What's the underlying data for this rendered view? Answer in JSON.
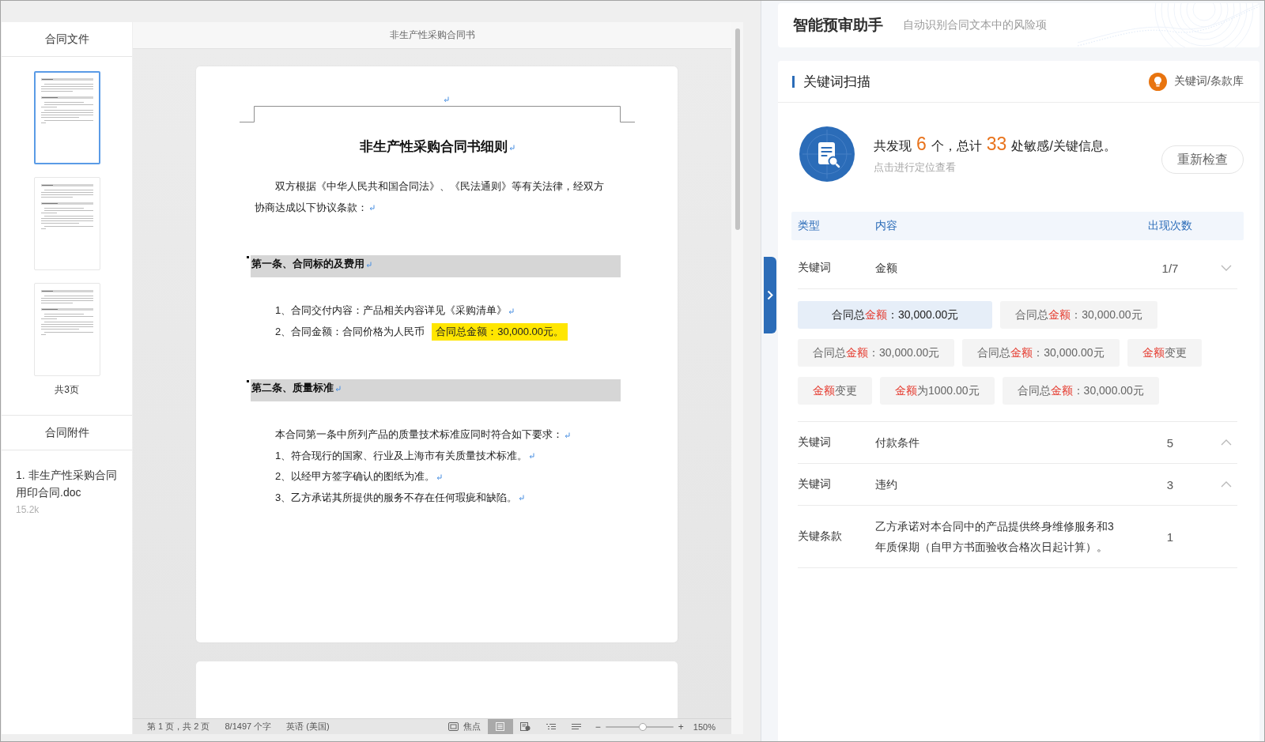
{
  "sidebar": {
    "title": "合同文件",
    "pages": [
      {
        "selected": true
      },
      {
        "selected": false
      },
      {
        "selected": false
      }
    ],
    "page_count": "共3页",
    "attachments_title": "合同附件",
    "attachments": [
      {
        "name": "1. 非生产性采购合同用印合同.doc",
        "size": "15.2k"
      }
    ]
  },
  "document": {
    "tab_title": "非生产性采购合同书",
    "header_mark": true,
    "blocks": [
      {
        "kind": "title",
        "text": "非生产性采购合同书细则",
        "mark": true
      },
      {
        "kind": "paragraph",
        "text": "双方根据《中华人民共和国合同法》、《民法通则》等有关法律，经双方协商达成以下协议条款：",
        "mark": true
      },
      {
        "kind": "heading",
        "text": "第一条、合同标的及费用",
        "mark": true
      },
      {
        "kind": "paragraph",
        "text": "1、合同交付内容：产品相关内容详见《采购清单》",
        "mark": true
      },
      {
        "kind": "paragraph",
        "text": "2、合同金额：合同价格为人民币",
        "highlight": "合同总金额：30,000.00元。",
        "mark": false
      },
      {
        "kind": "heading",
        "text": "第二条、质量标准",
        "mark": true
      },
      {
        "kind": "paragraph",
        "text": "本合同第一条中所列产品的质量技术标准应同时符合如下要求：",
        "mark": true
      },
      {
        "kind": "paragraph",
        "text": "1、符合现行的国家、行业及上海市有关质量技术标准。",
        "mark": true
      },
      {
        "kind": "paragraph",
        "text": "2、以经甲方签字确认的图纸为准。",
        "mark": true
      },
      {
        "kind": "paragraph",
        "text": "3、乙方承诺其所提供的服务不存在任何瑕疵和缺陷。",
        "mark": true
      }
    ]
  },
  "status_bar": {
    "page_info": "第 1 页，共 2 页",
    "word_count": "8/1497 个字",
    "language": "英语 (美国)",
    "focus": "焦点",
    "view_modes": [
      {
        "kind": "print",
        "selected": true
      },
      {
        "kind": "web",
        "selected": false
      },
      {
        "kind": "outline",
        "selected": false
      },
      {
        "kind": "draft",
        "selected": false
      }
    ],
    "zoom_out": "−",
    "zoom": {
      "level": 0.56
    },
    "zoom_in": "+",
    "zoom_value": "150%"
  },
  "assistant": {
    "title": "智能预审助手",
    "subtitle": "自动识别合同文本中的风险项",
    "scan": {
      "title": "关键词扫描",
      "library_link": "关键词/条款库",
      "summary": [
        {
          "kind": "text",
          "text": "共发现"
        },
        {
          "kind": "count",
          "text": "6"
        },
        {
          "kind": "text",
          "text": "个，总计"
        },
        {
          "kind": "count",
          "text": "33"
        },
        {
          "kind": "text",
          "text": "处敏感/关键信息。"
        }
      ],
      "hint": "点击进行定位查看",
      "recheck": "重新检查",
      "columns": [
        "类型",
        "内容",
        "出现次数"
      ],
      "results": [
        {
          "kind": "keyword",
          "type": "关键词",
          "content": "金额",
          "count": "1/7",
          "expanded": true,
          "matches": [
            {
              "selected": true,
              "before": "合同总",
              "keyword": "金额",
              "after": "：30,000.00元"
            },
            {
              "selected": false,
              "before": "合同总",
              "keyword": "金额",
              "after": "：30,000.00元"
            },
            {
              "selected": false,
              "before": "合同总",
              "keyword": "金额",
              "after": "：30,000.00元"
            },
            {
              "selected": false,
              "before": "合同总",
              "keyword": "金额",
              "after": "：30,000.00元"
            },
            {
              "selected": false,
              "keyword": "金额",
              "after": "变更"
            },
            {
              "selected": false,
              "keyword": "金额",
              "after": "变更"
            },
            {
              "selected": false,
              "keyword": "金额",
              "after": "为1000.00元"
            },
            {
              "selected": false,
              "before": "合同总",
              "keyword": "金额",
              "after": "：30,000.00元"
            }
          ]
        },
        {
          "kind": "keyword",
          "type": "关键词",
          "content": "付款条件",
          "count": "5",
          "expanded": false
        },
        {
          "kind": "keyword",
          "type": "关键词",
          "content": "违约",
          "count": "3",
          "expanded": false
        },
        {
          "kind": "clause",
          "type": "关键条款",
          "content": "乙方承诺对本合同中的产品提供终身维修服务和3年质保期（自甲方书面验收合格次日起计算）。",
          "count": "1"
        }
      ]
    }
  }
}
